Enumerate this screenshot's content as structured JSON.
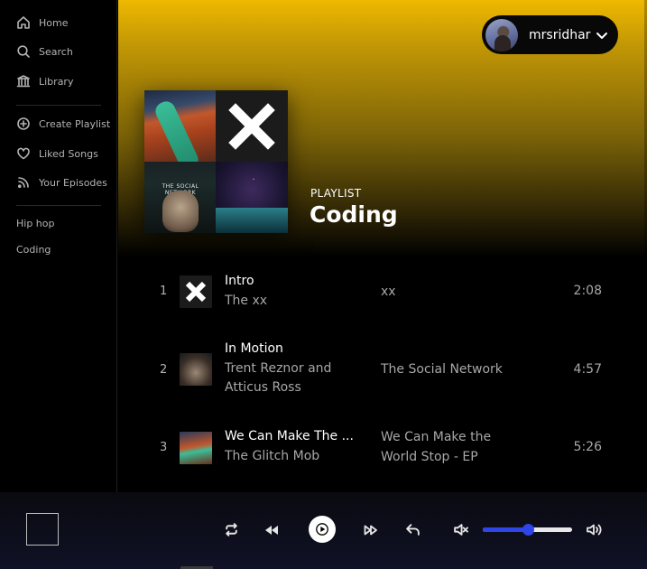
{
  "sidebar": {
    "nav": [
      {
        "label": "Home",
        "icon": "home-icon"
      },
      {
        "label": "Search",
        "icon": "search-icon"
      },
      {
        "label": "Library",
        "icon": "library-icon"
      }
    ],
    "actions": [
      {
        "label": "Create Playlist",
        "icon": "plus-circle-icon"
      },
      {
        "label": "Liked Songs",
        "icon": "heart-icon"
      },
      {
        "label": "Your Episodes",
        "icon": "rss-icon"
      }
    ],
    "playlists": [
      "Hip hop",
      "Coding"
    ]
  },
  "user": {
    "name": "mrsridhar"
  },
  "playlist": {
    "label": "PLAYLIST",
    "title": "Coding"
  },
  "tracks": [
    {
      "num": "1",
      "name": "Intro",
      "artist": "The xx",
      "album": "xx",
      "duration": "2:08"
    },
    {
      "num": "2",
      "name": "In Motion",
      "artist": "Trent Reznor and Atticus Ross",
      "album": "The Social Network",
      "duration": "4:57"
    },
    {
      "num": "3",
      "name": "We Can Make The ...",
      "artist": "The Glitch Mob",
      "album": "We Can Make the World Stop - EP",
      "duration": "5:26"
    }
  ],
  "cover_art": {
    "social_network_text": "THE SOCIAL NETWORK"
  },
  "player": {
    "volume": 0.5
  },
  "colors": {
    "accent": "#2e46e8",
    "gradient_top": "#efb900"
  }
}
